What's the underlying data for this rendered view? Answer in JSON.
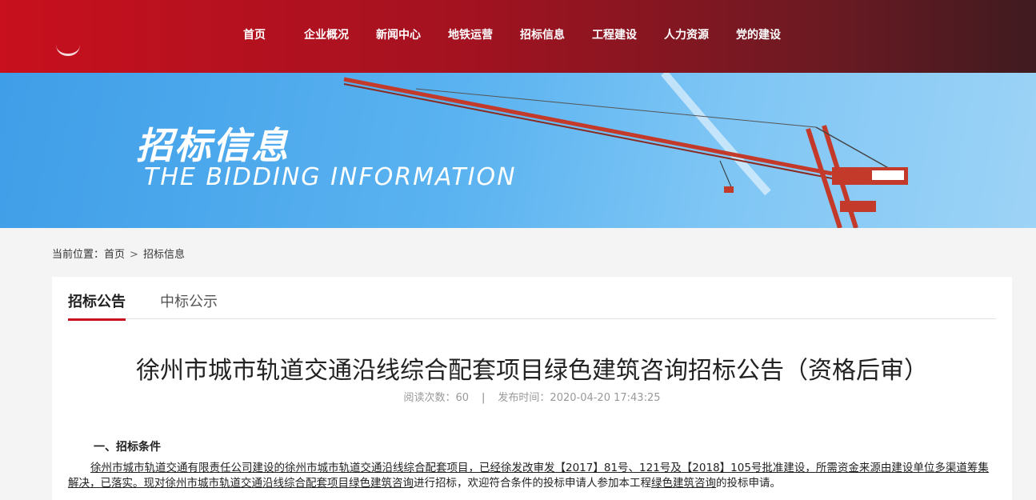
{
  "nav": {
    "items": [
      "首页",
      "企业概况",
      "新闻中心",
      "地铁运营",
      "招标信息",
      "工程建设",
      "人力资源",
      "党的建设"
    ]
  },
  "banner": {
    "title_cn": "招标信息",
    "title_en": "THE BIDDING INFORMATION"
  },
  "breadcrumb": {
    "label": "当前位置：",
    "home": "首页",
    "separator": ">",
    "current": "招标信息"
  },
  "tabs": {
    "active": "招标公告",
    "other": "中标公示"
  },
  "article": {
    "title": "徐州市城市轨道交通沿线综合配套项目绿色建筑咨询招标公告（资格后审）",
    "read_count": "阅读次数：60",
    "divider": "|",
    "publish_time": "发布时间：2020-04-20 17:43:25",
    "section_heading": "一、招标条件",
    "paragraph_part1": "徐州市城市轨道交通有限责任公司建设的徐州市城市轨道交通沿线综合配套项目，已经徐发改审发【2017】81号、121号及【2018】105号批准建设，所需资金来源由建设单位多渠道筹集解决，已落实。现对徐州市城市轨道交通沿线综合配套项目",
    "paragraph_link": "绿色建筑咨询",
    "paragraph_part2": "进行招标，欢迎符合条件的投标申请人参加本工程",
    "paragraph_link2": "绿色建筑咨询",
    "paragraph_part3": "的投标申请。"
  },
  "colors": {
    "header_red": "#c8101e",
    "header_dark": "#3f1b20",
    "accent": "#c8101e",
    "sky": "#5bb3f0"
  }
}
